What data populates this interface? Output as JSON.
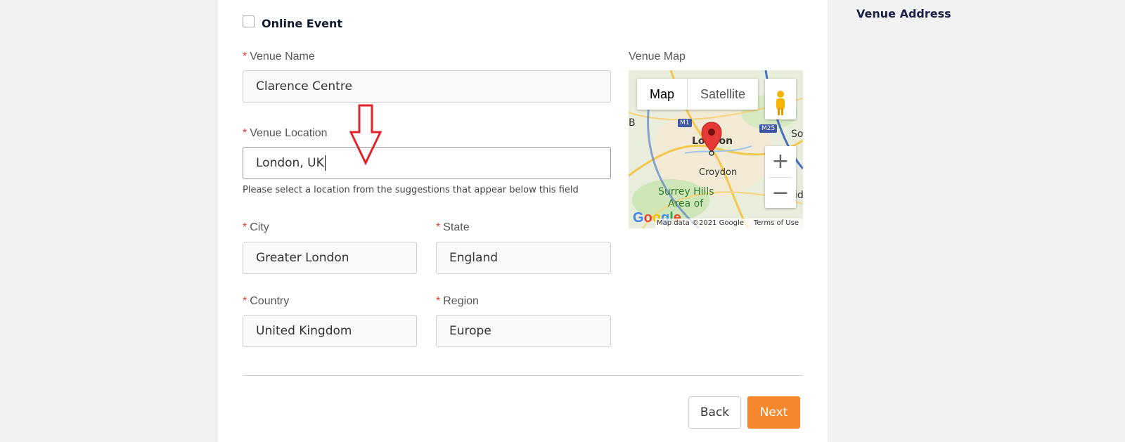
{
  "sidebar": {
    "title": "Venue Address"
  },
  "form": {
    "online_event_label": "Online Event",
    "required_mark": "*",
    "venue_name": {
      "label": "Venue Name",
      "value": "Clarence Centre"
    },
    "venue_location": {
      "label": "Venue Location",
      "value": "London, UK",
      "helper": "Please select a location from the suggestions that appear below this field"
    },
    "city": {
      "label": "City",
      "value": "Greater London"
    },
    "state": {
      "label": "State",
      "value": "England"
    },
    "country": {
      "label": "Country",
      "value": "United Kingdom"
    },
    "region": {
      "label": "Region",
      "value": "Europe"
    }
  },
  "map": {
    "label": "Venue Map",
    "tab_map": "Map",
    "tab_satellite": "Satellite",
    "zoom_in": "+",
    "zoom_out": "−",
    "places": {
      "london": "London",
      "croydon": "Croydon",
      "surrey": "Surrey Hills",
      "area": "Area of",
      "partial_so": "So",
      "partial_b": "B",
      "partial_id": "id"
    },
    "roads": {
      "m1": "M1",
      "m25": "M25"
    },
    "google": "Google",
    "attribution": "Map data ©2021 Google",
    "terms": "Terms of Use"
  },
  "buttons": {
    "back": "Back",
    "next": "Next"
  },
  "colors": {
    "accent": "#f5882c",
    "required": "#e53935",
    "annotation_arrow": "#e0242b"
  }
}
